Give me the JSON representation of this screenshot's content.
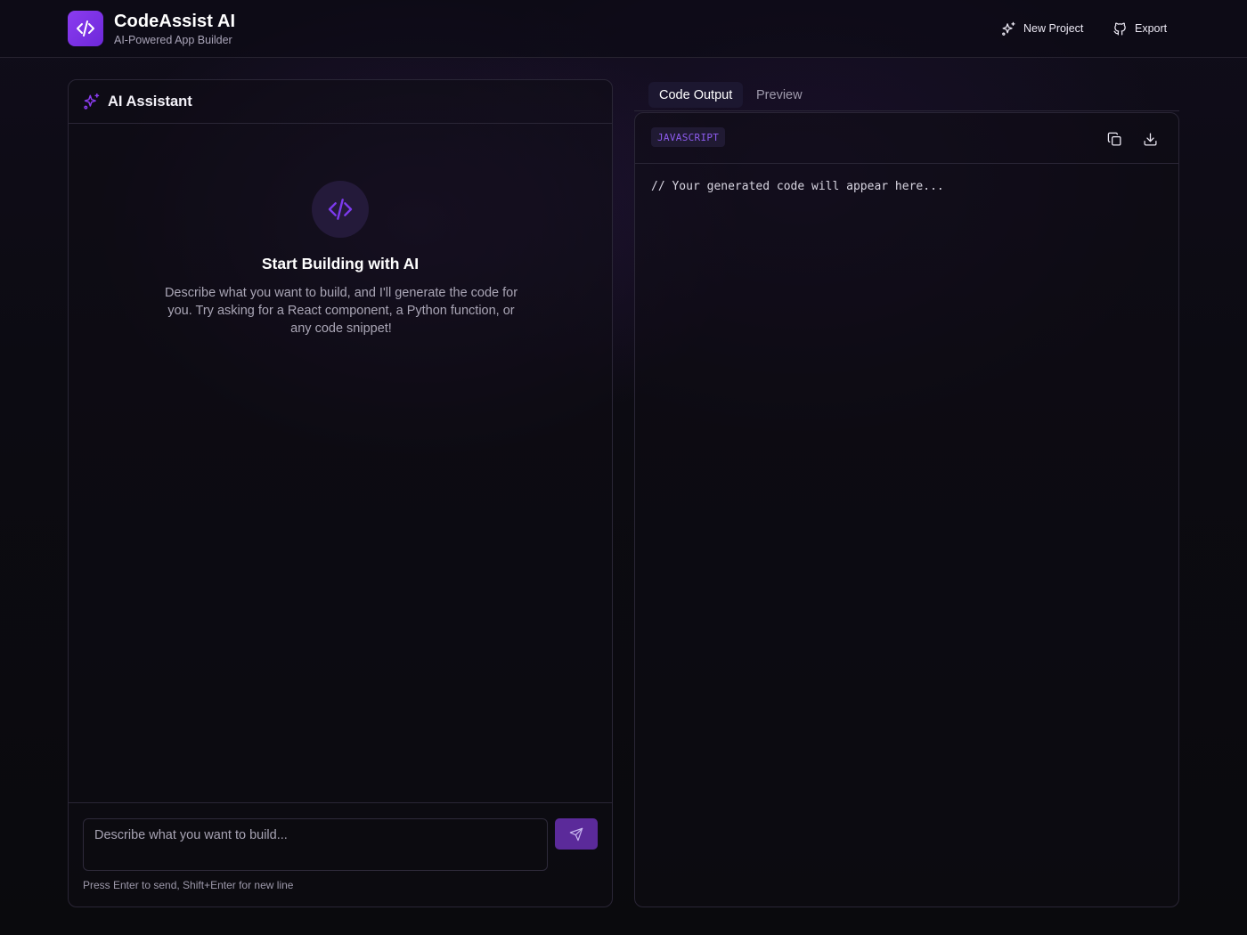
{
  "header": {
    "title": "CodeAssist AI",
    "subtitle": "AI-Powered App Builder",
    "new_project_label": "New Project",
    "export_label": "Export",
    "logo_icon": "code-icon",
    "new_project_icon": "sparkles-icon",
    "export_icon": "github-icon"
  },
  "assistant": {
    "title": "AI Assistant",
    "title_icon": "sparkles-icon",
    "empty_state": {
      "icon": "code-icon",
      "heading": "Start Building with AI",
      "description": "Describe what you want to build, and I'll generate the code for you. Try asking for a React component, a Python function, or any code snippet!"
    },
    "input": {
      "placeholder": "Describe what you want to build...",
      "value": ""
    },
    "send_icon": "send-icon",
    "hint": "Press Enter to send, Shift+Enter for new line"
  },
  "output": {
    "tabs": [
      {
        "label": "Code Output",
        "active": true
      },
      {
        "label": "Preview",
        "active": false
      }
    ],
    "language": "JAVASCRIPT",
    "copy_icon": "copy-icon",
    "download_icon": "download-icon",
    "code": "// Your generated code will appear here..."
  },
  "colors": {
    "accent": "#7c3aed",
    "accent_light": "#8e5cf0",
    "background": "#0b0b0f",
    "border": "#2a2636"
  }
}
